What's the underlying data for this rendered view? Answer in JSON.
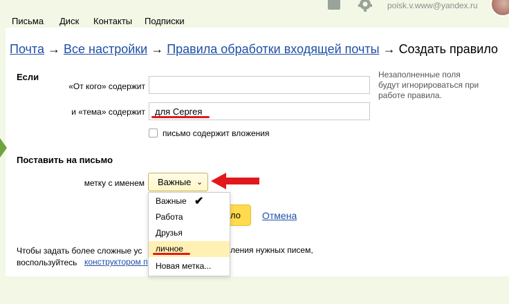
{
  "nav": {
    "items": [
      {
        "label": "Письма"
      },
      {
        "label": "Диск"
      },
      {
        "label": "Контакты"
      },
      {
        "label": "Подписки"
      }
    ],
    "account": "poisk.v.www@yandex.ru"
  },
  "breadcrumb": {
    "mail": "Почта",
    "all_settings": "Все настройки",
    "rules": "Правила обработки входящей почты",
    "separator": "→",
    "current": "Создать правило"
  },
  "if_section": {
    "title": "Если",
    "from_label": "«От кого» содержит",
    "from_value": "",
    "subject_label": "и «тема» содержит",
    "subject_value": "для Сергея",
    "attachments_label": "письмо содержит вложения",
    "hint": "Незаполненные поля будут игнорироваться при работе правила."
  },
  "action_section": {
    "title": "Поставить на письмо",
    "label_name": "метку с именем",
    "selected_label": "Важные",
    "options": [
      "Важные",
      "Работа",
      "Друзья",
      "личное",
      "Новая метка..."
    ],
    "highlighted_option": "личное"
  },
  "buttons": {
    "save_partial": "ло",
    "cancel": "Отмена"
  },
  "footer": {
    "line1_left": "Чтобы задать более сложные ус",
    "line1_right": "ления нужных писем,",
    "line2_left": "воспользуйтесь",
    "line2_link": "конструктором п"
  },
  "colors": {
    "link": "#1f4fa6",
    "top_bar": "#f2f7e6",
    "save_button": "#ffdb4d",
    "highlight": "#fff0b3",
    "annotation_red": "#e3181b"
  }
}
